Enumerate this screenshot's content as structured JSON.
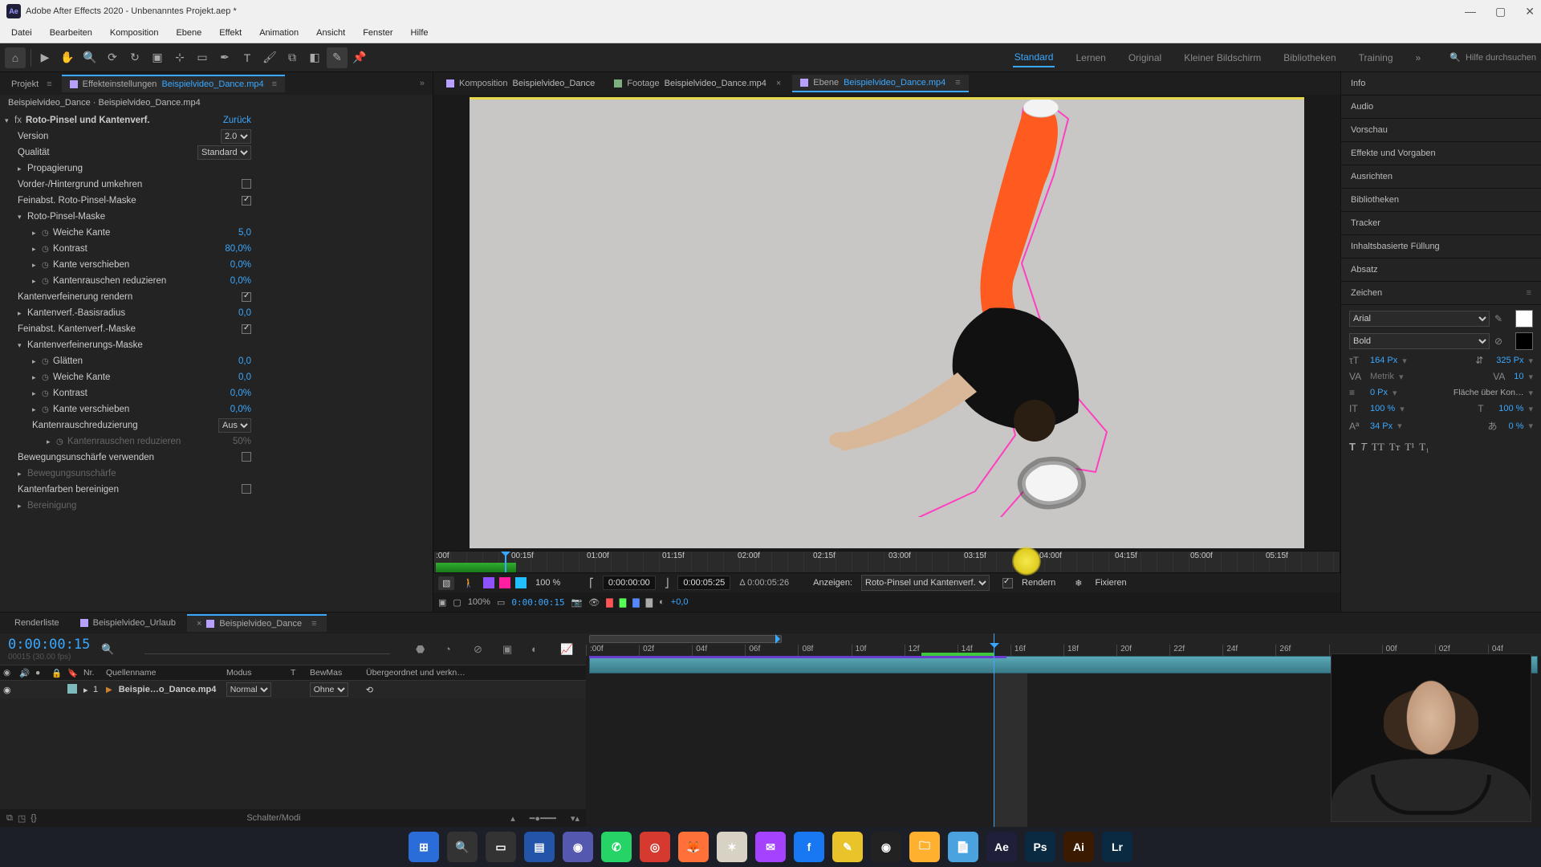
{
  "title": "Adobe After Effects 2020 - Unbenanntes Projekt.aep *",
  "menu": [
    "Datei",
    "Bearbeiten",
    "Komposition",
    "Ebene",
    "Effekt",
    "Animation",
    "Ansicht",
    "Fenster",
    "Hilfe"
  ],
  "workspaces": [
    "Standard",
    "Lernen",
    "Original",
    "Kleiner Bildschirm",
    "Bibliotheken",
    "Training"
  ],
  "workspace_active": "Standard",
  "search_placeholder": "Hilfe durchsuchen",
  "left_tabs": {
    "project": "Projekt",
    "fx_prefix": "Effekteinstellungen",
    "fx_link": "Beispielvideo_Dance.mp4"
  },
  "crumb": "Beispielvideo_Dance · Beispielvideo_Dance.mp4",
  "fx": {
    "name": "Roto-Pinsel und Kantenverf.",
    "reset": "Zurück",
    "version_label": "Version",
    "version": "2.0",
    "quality_label": "Qualität",
    "quality": "Standard",
    "prop": "Propagierung",
    "invert": "Vorder-/Hintergrund umkehren",
    "fine_roto": "Feinabst. Roto-Pinsel-Maske",
    "mask_roto": "Roto-Pinsel-Maske",
    "feather_label": "Weiche Kante",
    "feather": "5,0",
    "contrast_label": "Kontrast",
    "contrast": "80,0%",
    "shift_label": "Kante verschieben",
    "shift": "0,0%",
    "noise_label": "Kantenrauschen reduzieren",
    "noise": "0,0%",
    "render_refine": "Kantenverfeinerung rendern",
    "base_radius_label": "Kantenverf.-Basisradius",
    "base_radius": "0,0",
    "fine_refine": "Feinabst. Kantenverf.-Maske",
    "refine_mask": "Kantenverfeinerungs-Maske",
    "smooth_label": "Glätten",
    "smooth": "0,0",
    "feather2": "0,0",
    "contrast2": "0,0%",
    "shift2": "0,0%",
    "chatter_label": "Kantenrauschreduzierung",
    "chatter": "Aus",
    "chatter_reduce": "Kantenrauschen reduzieren",
    "chatter_reduce_v": "50%",
    "motion_blur": "Bewegungsunschärfe verwenden",
    "motion_blur_sub": "Bewegungsunschärfe",
    "decon": "Kantenfarben bereinigen",
    "decon_sub": "Bereinigung"
  },
  "viewer_tabs": {
    "comp_prefix": "Komposition",
    "comp_link": "Beispielvideo_Dance",
    "footage_prefix": "Footage",
    "footage_link": "Beispielvideo_Dance.mp4",
    "layer_prefix": "Ebene",
    "layer_link": "Beispielvideo_Dance.mp4"
  },
  "ftl_labels": [
    ":00f",
    "00:15f",
    "01:00f",
    "01:15f",
    "02:00f",
    "02:15f",
    "03:00f",
    "03:15f",
    "04:00f",
    "04:15f",
    "05:00f",
    "05:15f"
  ],
  "fc": {
    "pct": "100 %",
    "in": "0:00:00:00",
    "out": "0:00:05:25",
    "delta": "Δ 0:00:05:26",
    "show_label": "Anzeigen:",
    "show": "Roto-Pinsel und Kantenverf.",
    "render": "Rendern",
    "freeze": "Fixieren"
  },
  "fc2": {
    "zoom": "100%",
    "time": "0:00:00:15",
    "offset": "+0,0"
  },
  "right_panels": [
    "Info",
    "Audio",
    "Vorschau",
    "Effekte und Vorgaben",
    "Ausrichten",
    "Bibliotheken",
    "Tracker",
    "Inhaltsbasierte Füllung",
    "Absatz",
    "Zeichen"
  ],
  "char": {
    "font": "Arial",
    "weight": "Bold",
    "size": "164 Px",
    "leading": "325 Px",
    "kerning": "Metrik",
    "tracking": "10",
    "stroke": "0 Px",
    "fill_over": "Fläche über Kon…",
    "vscale": "100 %",
    "hscale": "100 %",
    "baseline": "34 Px",
    "tsume": "0 %"
  },
  "bt_tabs": {
    "render": "Renderliste",
    "t1": "Beispielvideo_Urlaub",
    "t2": "Beispielvideo_Dance"
  },
  "tc": {
    "time": "0:00:00:15",
    "hint": "00015 (30.00 fps)"
  },
  "layer_head": {
    "nr": "Nr.",
    "src": "Quellenname",
    "mode": "Modus",
    "t": "T",
    "trk": "BewMas",
    "parent": "Übergeordnet und verkn…"
  },
  "layer": {
    "num": "1",
    "name": "Beispie…o_Dance.mp4",
    "mode": "Normal",
    "trk": "Ohne"
  },
  "bt_footer": "Schalter/Modi",
  "tl_ticks": [
    ":00f",
    "02f",
    "04f",
    "06f",
    "08f",
    "10f",
    "12f",
    "14f",
    "16f",
    "18f",
    "20f",
    "22f",
    "24f",
    "26f",
    "",
    "00f",
    "02f",
    "04f"
  ],
  "taskbar_apps": [
    {
      "n": "start",
      "bg": "#2b6dd8",
      "t": "⊞"
    },
    {
      "n": "search",
      "bg": "#333",
      "t": "🔍"
    },
    {
      "n": "tasks",
      "bg": "#333",
      "t": "▭"
    },
    {
      "n": "widgets",
      "bg": "#2255aa",
      "t": "▤"
    },
    {
      "n": "teams",
      "bg": "#5558af",
      "t": "◉"
    },
    {
      "n": "whatsapp",
      "bg": "#25d366",
      "t": "✆"
    },
    {
      "n": "app-red",
      "bg": "#d63a2f",
      "t": "◎"
    },
    {
      "n": "firefox",
      "bg": "#ff7139",
      "t": "🦊"
    },
    {
      "n": "app-figure",
      "bg": "#d7d2c4",
      "t": "✶"
    },
    {
      "n": "messenger",
      "bg": "#a542ff",
      "t": "✉"
    },
    {
      "n": "facebook",
      "bg": "#1877f2",
      "t": "f"
    },
    {
      "n": "notes",
      "bg": "#e8c32a",
      "t": "✎"
    },
    {
      "n": "obs",
      "bg": "#222",
      "t": "◉"
    },
    {
      "n": "files",
      "bg": "#ffb02e",
      "t": "🗀"
    },
    {
      "n": "notepad",
      "bg": "#4aa3df",
      "t": "📄"
    },
    {
      "n": "ae",
      "bg": "#1f1f3a",
      "t": "Ae"
    },
    {
      "n": "ps",
      "bg": "#0a2a42",
      "t": "Ps"
    },
    {
      "n": "ai",
      "bg": "#3a1a00",
      "t": "Ai"
    },
    {
      "n": "lr",
      "bg": "#0a2a42",
      "t": "Lr"
    }
  ]
}
